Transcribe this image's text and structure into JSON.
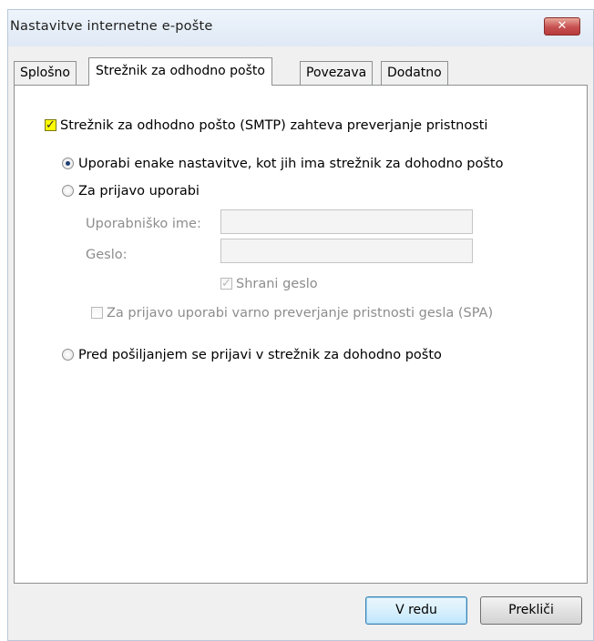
{
  "window": {
    "title": "Nastavitve internetne e-pošte",
    "close_glyph": "✕"
  },
  "tabs": [
    {
      "label": "Splošno",
      "active": false
    },
    {
      "label": "Strežnik za odhodno pošto",
      "active": true
    },
    {
      "label": "Povezava",
      "active": false
    },
    {
      "label": "Dodatno",
      "active": false
    }
  ],
  "smtp": {
    "requires_auth_label": "Strežnik za odhodno pošto (SMTP) zahteva preverjanje pristnosti",
    "requires_auth_checked": true,
    "option_same": "Uporabi enake nastavitve, kot jih ima strežnik za dohodno pošto",
    "option_login": "Za prijavo uporabi",
    "username_label": "Uporabniško ime:",
    "username_value": "",
    "password_label": "Geslo:",
    "password_value": "",
    "save_password_label": "Shrani geslo",
    "save_password_checked": true,
    "spa_label": "Za prijavo uporabi varno preverjanje pristnosti gesla (SPA)",
    "spa_checked": false,
    "option_before_send": "Pred pošiljanjem se prijavi v strežnik za dohodno pošto",
    "selected_option": "same"
  },
  "buttons": {
    "ok": "V redu",
    "cancel": "Prekliči"
  },
  "colors": {
    "highlight": "#ffff00",
    "close_button": "#c75050",
    "default_button_border": "#3c7fb1"
  }
}
